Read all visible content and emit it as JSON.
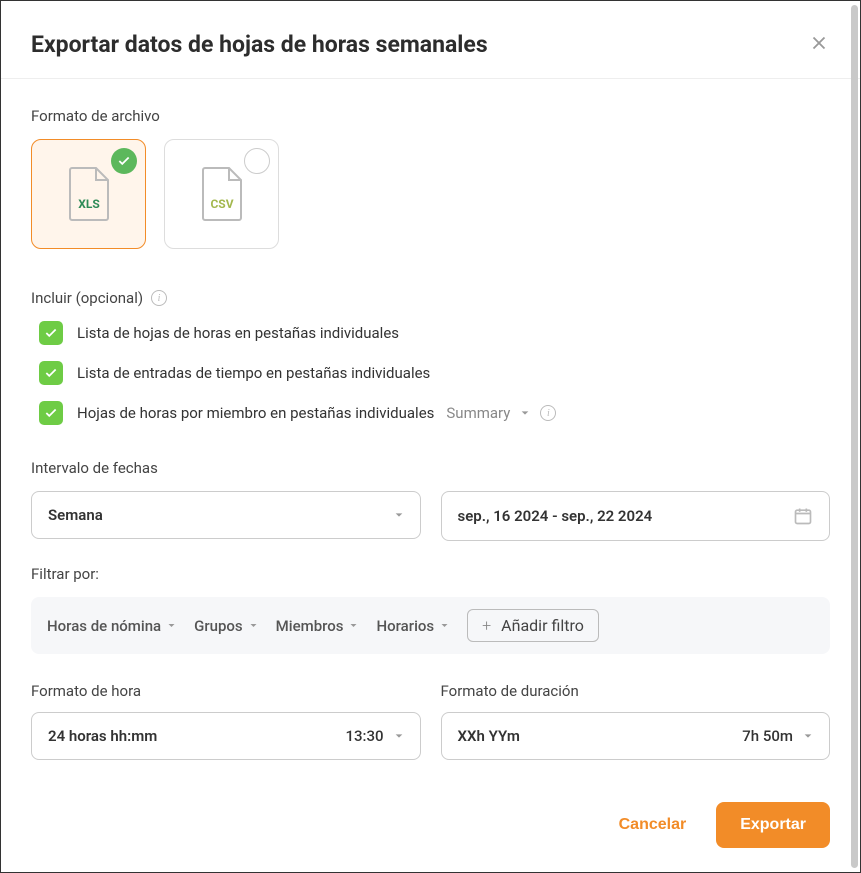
{
  "header": {
    "title": "Exportar datos de hojas de horas semanales"
  },
  "file_format": {
    "label": "Formato de archivo",
    "options": [
      {
        "id": "xls",
        "label": "XLS",
        "selected": true
      },
      {
        "id": "csv",
        "label": "CSV",
        "selected": false
      }
    ]
  },
  "include": {
    "label": "Incluir (opcional)",
    "items": [
      {
        "label": "Lista de hojas de horas en pestañas individuales",
        "checked": true
      },
      {
        "label": "Lista de entradas de tiempo en pestañas individuales",
        "checked": true
      },
      {
        "label": "Hojas de horas por miembro en pestañas individuales",
        "checked": true,
        "extra": "Summary"
      }
    ]
  },
  "date_range": {
    "label": "Intervalo de fechas",
    "period": "Semana",
    "range": "sep., 16 2024 - sep., 22 2024"
  },
  "filter": {
    "label": "Filtrar por:",
    "items": [
      "Horas de nómina",
      "Grupos",
      "Miembros",
      "Horarios"
    ],
    "add_label": "Añadir filtro"
  },
  "time_format": {
    "label": "Formato de hora",
    "value": "24 horas hh:mm",
    "preview": "13:30"
  },
  "duration_format": {
    "label": "Formato de duración",
    "value": "XXh YYm",
    "preview": "7h 50m"
  },
  "footer": {
    "cancel": "Cancelar",
    "export": "Exportar"
  }
}
